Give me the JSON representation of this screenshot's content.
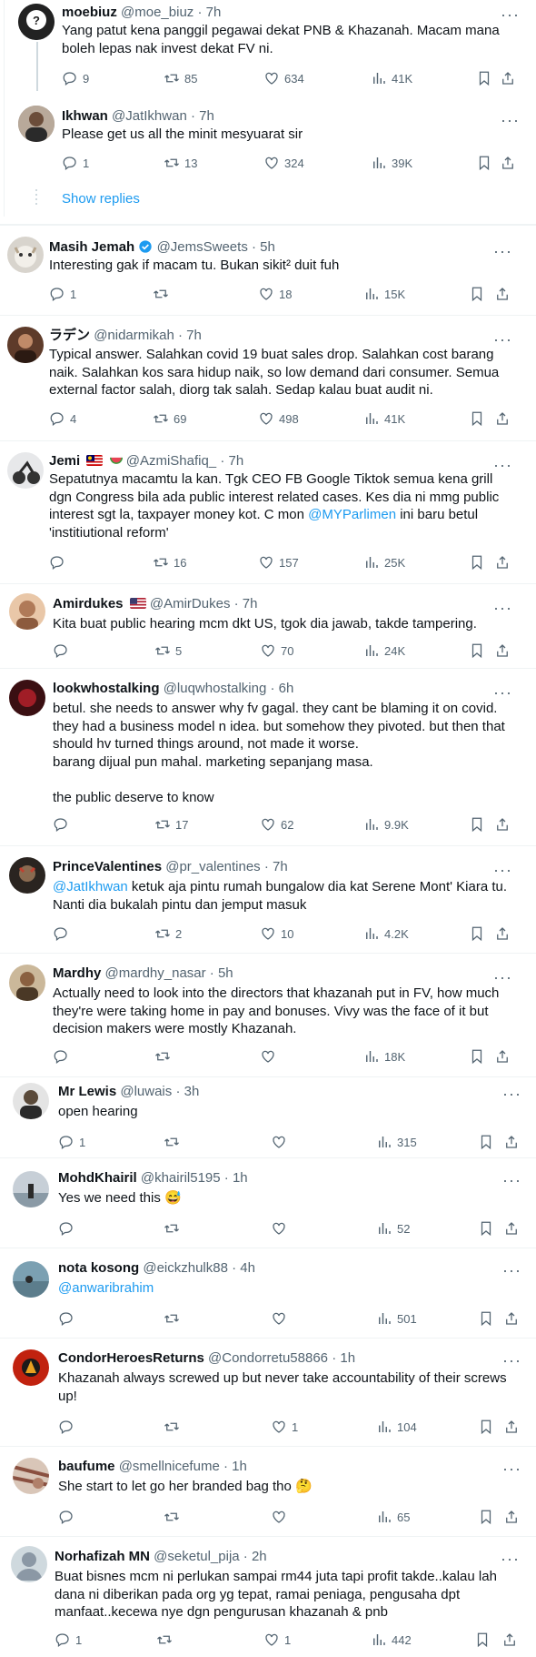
{
  "replies": [
    {
      "name": "moebiuz",
      "handle": "@moe_biuz",
      "time": "· 7h",
      "text": [
        "Yang patut kena panggil pegawai dekat PNB & Khazanah. Macam mana boleh lepas nak invest dekat FV ni."
      ],
      "replies": "9",
      "retweets": "85",
      "likes": "634",
      "views": "41K"
    },
    {
      "name": "Ikhwan",
      "handle": "@JatIkhwan",
      "time": "· 7h",
      "text": [
        "Please get us all the minit mesyuarat sir"
      ],
      "replies": "1",
      "retweets": "13",
      "likes": "324",
      "views": "39K"
    },
    {
      "name": "Masih Jemah",
      "handle": "@JemsSweets",
      "time": "· 5h",
      "text": [
        "Interesting gak if macam tu. Bukan sikit² duit fuh"
      ],
      "replies": "1",
      "retweets": "",
      "likes": "18",
      "views": "15K"
    },
    {
      "name": "ラデン",
      "handle": "@nidarmikah",
      "time": "· 7h",
      "text": [
        "Typical answer. Salahkan covid 19 buat sales drop. Salahkan cost barang naik. Salahkan kos sara hidup naik, so low demand dari consumer. Semua external factor salah, diorg tak salah. Sedap kalau buat audit ni."
      ],
      "replies": "4",
      "retweets": "69",
      "likes": "498",
      "views": "41K"
    },
    {
      "name": "Jemi",
      "handle": "@AzmiShafiq_",
      "time": "· 7h",
      "text_a": "Sepatutnya macamtu la kan. Tgk CEO FB Google Tiktok semua kena grill dgn Congress bila ada public interest related cases. Kes dia ni mmg public interest sgt la, taxpayer money kot. C mon ",
      "mention": "@MYParlimen",
      "text_b": " ini baru betul 'institiutional reform'",
      "replies": "",
      "retweets": "16",
      "likes": "157",
      "views": "25K"
    },
    {
      "name": "Amirdukes",
      "handle": "@AmirDukes",
      "time": "· 7h",
      "text": [
        "Kita buat public hearing mcm dkt US, tgok dia jawab, takde tampering."
      ],
      "replies": "",
      "retweets": "5",
      "likes": "70",
      "views": "24K"
    },
    {
      "name": "lookwhostalking",
      "handle": "@luqwhostalking",
      "time": "· 6h",
      "text": [
        "betul. she needs to answer why fv gagal. they cant be blaming it on covid. they had a business model n idea. but somehow they pivoted. but then that should hv turned things around, not made it worse.",
        "barang dijual pun mahal. marketing sepanjang masa.",
        "",
        "the public deserve to know"
      ],
      "replies": "",
      "retweets": "17",
      "likes": "62",
      "views": "9.9K"
    },
    {
      "name": "PrinceValentines",
      "handle": "@pr_valentines",
      "time": "· 7h",
      "mention": "@JatIkhwan",
      "text_b": " ketuk aja pintu rumah bungalow dia kat Serene Mont' Kiara tu. Nanti dia bukalah pintu dan jemput masuk",
      "replies": "",
      "retweets": "2",
      "likes": "10",
      "views": "4.2K"
    },
    {
      "name": "Mardhy",
      "handle": "@mardhy_nasar",
      "time": "· 5h",
      "text": [
        "Actually need to look into the directors that khazanah put in FV, how much they're were taking home in pay and bonuses. Vivy was the face of it but decision makers were mostly Khazanah."
      ],
      "replies": "",
      "retweets": "",
      "likes": "",
      "views": "18K"
    },
    {
      "name": "Mr Lewis",
      "handle": "@luwais",
      "time": "· 3h",
      "text": [
        "open hearing"
      ],
      "replies": "1",
      "retweets": "",
      "likes": "",
      "views": "315"
    },
    {
      "name": "MohdKhairil",
      "handle": "@khairil5195",
      "time": "· 1h",
      "text": [
        "Yes we need this 😅"
      ],
      "replies": "",
      "retweets": "",
      "likes": "",
      "views": "52"
    },
    {
      "name": "nota kosong",
      "handle": "@eickzhulk88",
      "time": "· 4h",
      "mention": "@anwaribrahim",
      "text_b": "",
      "replies": "",
      "retweets": "",
      "likes": "",
      "views": "501"
    },
    {
      "name": "CondorHeroesReturns",
      "handle": "@Condorretu58866",
      "time": "· 1h",
      "text": [
        "Khazanah always screwed up but never take accountability of their screws up!"
      ],
      "replies": "",
      "retweets": "",
      "likes": "1",
      "views": "104"
    },
    {
      "name": "baufume",
      "handle": "@smellnicefume",
      "time": "· 1h",
      "text": [
        "She start to let go her branded bag tho 🤔"
      ],
      "replies": "",
      "retweets": "",
      "likes": "",
      "views": "65"
    },
    {
      "name": "Norhafizah MN",
      "handle": "@seketul_pija",
      "time": "· 2h",
      "text": [
        "Buat bisnes mcm ni perlukan sampai rm44 juta tapi profit takde..kalau lah dana ni diberikan pada org yg tepat, ramai peniaga, pengusaha dpt manfaat..kecewa nye dgn pengurusan khazanah & pnb"
      ],
      "replies": "1",
      "retweets": "",
      "likes": "1",
      "views": "442"
    }
  ],
  "show_replies": "Show replies",
  "colors": {
    "accent": "#1d9bf0",
    "muted": "#536471",
    "text": "#0f1419"
  }
}
